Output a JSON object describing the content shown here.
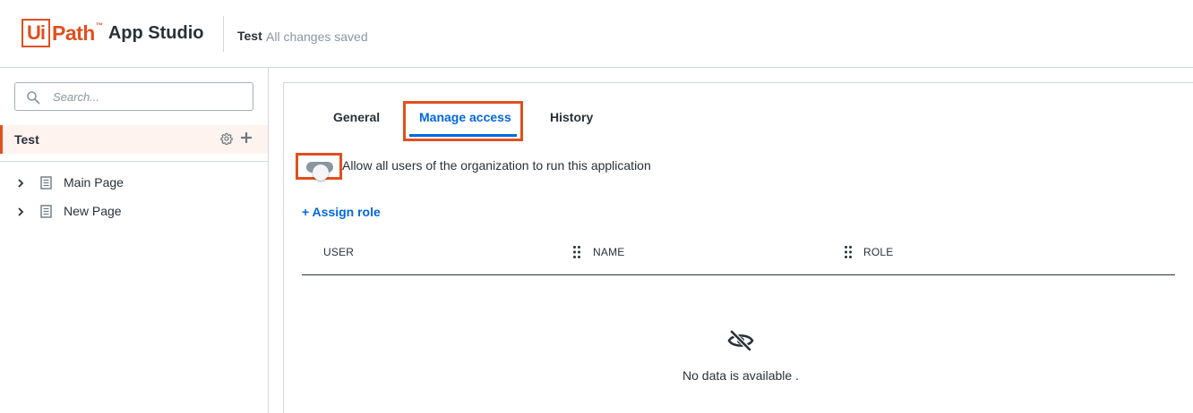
{
  "header": {
    "logo_ui": "Ui",
    "logo_path": "Path",
    "logo_tm": "™",
    "product_name": "App Studio",
    "project_name": "Test",
    "save_status": "All changes saved"
  },
  "sidebar": {
    "search_placeholder": "Search...",
    "search_value": "",
    "app_name": "Test",
    "pages": [
      {
        "label": "Main Page"
      },
      {
        "label": "New Page"
      }
    ]
  },
  "main": {
    "tabs": [
      {
        "label": "General",
        "active": false
      },
      {
        "label": "Manage access",
        "active": true
      },
      {
        "label": "History",
        "active": false
      }
    ],
    "toggle": {
      "label": "Allow all users of the organization to run this application",
      "on": false
    },
    "assign_role_label": "+ Assign role",
    "table": {
      "columns": [
        "USER",
        "NAME",
        "ROLE"
      ],
      "rows": []
    },
    "empty_text": "No data is available ."
  },
  "colors": {
    "brand": "#e0501e",
    "accent": "#0067df",
    "text": "#273139",
    "muted": "#8a97a0",
    "selected_bg": "#fef3ef"
  },
  "icons": [
    "search-icon",
    "gear-icon",
    "plus-icon",
    "chevron-right-icon",
    "page-icon",
    "drag-handle-icon",
    "eye-off-icon"
  ]
}
